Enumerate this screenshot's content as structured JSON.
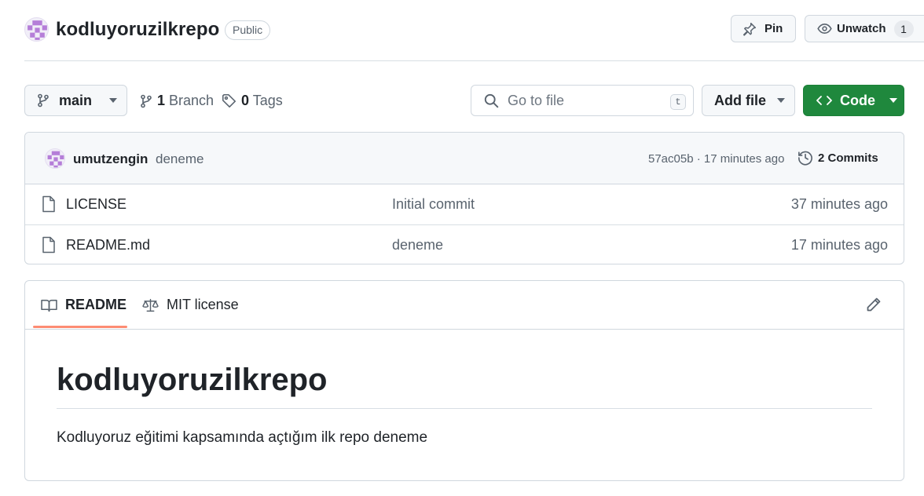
{
  "repo": {
    "name": "kodluyoruzilkrepo",
    "visibility": "Public"
  },
  "actions": {
    "pin_label": "Pin",
    "watch_label": "Unwatch",
    "watch_count": "1"
  },
  "toolbar": {
    "branch": "main",
    "branch_count": "1",
    "branch_label": "Branch",
    "tag_count": "0",
    "tag_label": "Tags",
    "search_placeholder": "Go to file",
    "search_shortcut": "t",
    "add_file_label": "Add file",
    "code_label": "Code"
  },
  "latest_commit": {
    "author": "umutzengin",
    "message": "deneme",
    "meta": "57ac05b · 17 minutes ago",
    "commits_label": "2 Commits"
  },
  "files": [
    {
      "name": "LICENSE",
      "commit": "Initial commit",
      "time": "37 minutes ago"
    },
    {
      "name": "README.md",
      "commit": "deneme",
      "time": "17 minutes ago"
    }
  ],
  "readme": {
    "tabs": [
      "README",
      "MIT license"
    ],
    "title": "kodluyoruzilkrepo",
    "body": "Kodluyoruz eğitimi kapsamında açtığım ilk repo deneme"
  },
  "colors": {
    "code_button": "#1f883d",
    "active_tab_underline": "#fd8c73",
    "avatar": "#b57ed8"
  }
}
